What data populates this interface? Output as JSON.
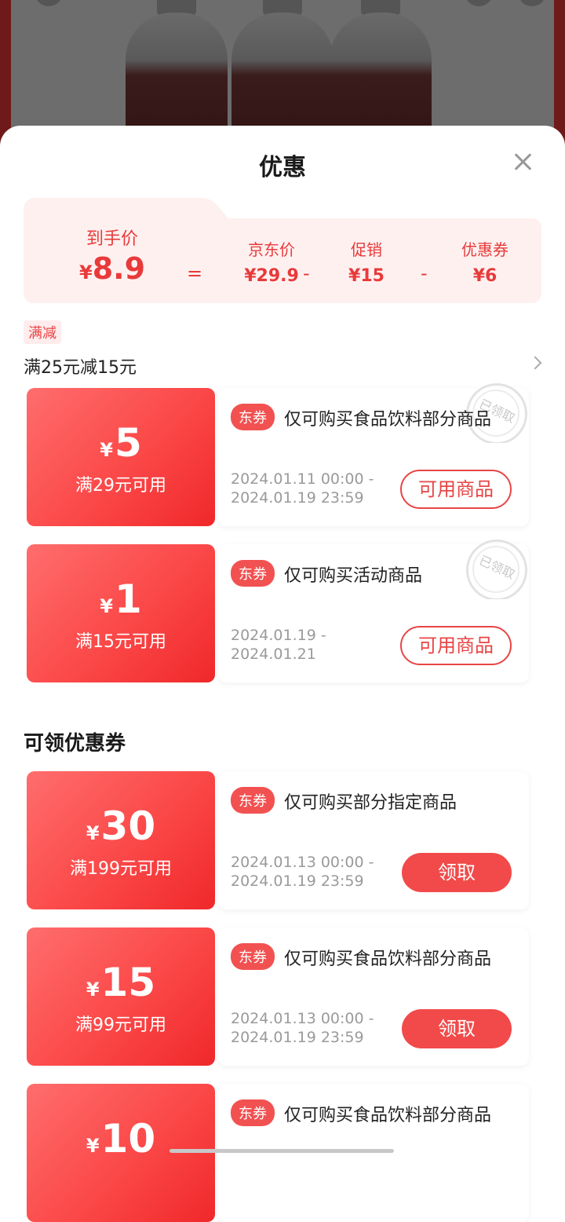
{
  "sheet": {
    "title": "优惠"
  },
  "price_breakdown": {
    "final_label": "到手价",
    "final_yen": "¥",
    "final_value": "8.9",
    "equals": "=",
    "jd_label": "京东价",
    "jd_value": "¥29.9",
    "minus1": "-",
    "promo_label": "促销",
    "promo_value": "¥15",
    "minus2": "-",
    "coupon_label": "优惠券",
    "coupon_value": "¥6"
  },
  "promotion": {
    "tag": "满减",
    "text": "满25元减15元"
  },
  "owned_coupons": [
    {
      "yen": "¥",
      "amount": "5",
      "condition": "满29元可用",
      "badge": "东券",
      "desc": "仅可购买食品饮料部分商品",
      "date_start": "2024.01.11 00:00 -",
      "date_end": "2024.01.19 23:59",
      "button": "可用商品",
      "stamp": "已领取"
    },
    {
      "yen": "¥",
      "amount": "1",
      "condition": "满15元可用",
      "badge": "东券",
      "desc": "仅可购买活动商品",
      "date_start": "2024.01.19 -",
      "date_end": "2024.01.21",
      "button": "可用商品",
      "stamp": "已领取"
    }
  ],
  "claimable_section": {
    "title": "可领优惠券"
  },
  "claimable_coupons": [
    {
      "yen": "¥",
      "amount": "30",
      "condition": "满199元可用",
      "badge": "东券",
      "desc": "仅可购买部分指定商品",
      "date_start": "2024.01.13 00:00 -",
      "date_end": "2024.01.19 23:59",
      "button": "领取"
    },
    {
      "yen": "¥",
      "amount": "15",
      "condition": "满99元可用",
      "badge": "东券",
      "desc": "仅可购买食品饮料部分商品",
      "date_start": "2024.01.13 00:00 -",
      "date_end": "2024.01.19 23:59",
      "button": "领取"
    },
    {
      "yen": "¥",
      "amount": "10",
      "condition": "",
      "badge": "东券",
      "desc": "仅可购买食品饮料部分商品",
      "date_start": "",
      "date_end": "",
      "button": ""
    }
  ]
}
